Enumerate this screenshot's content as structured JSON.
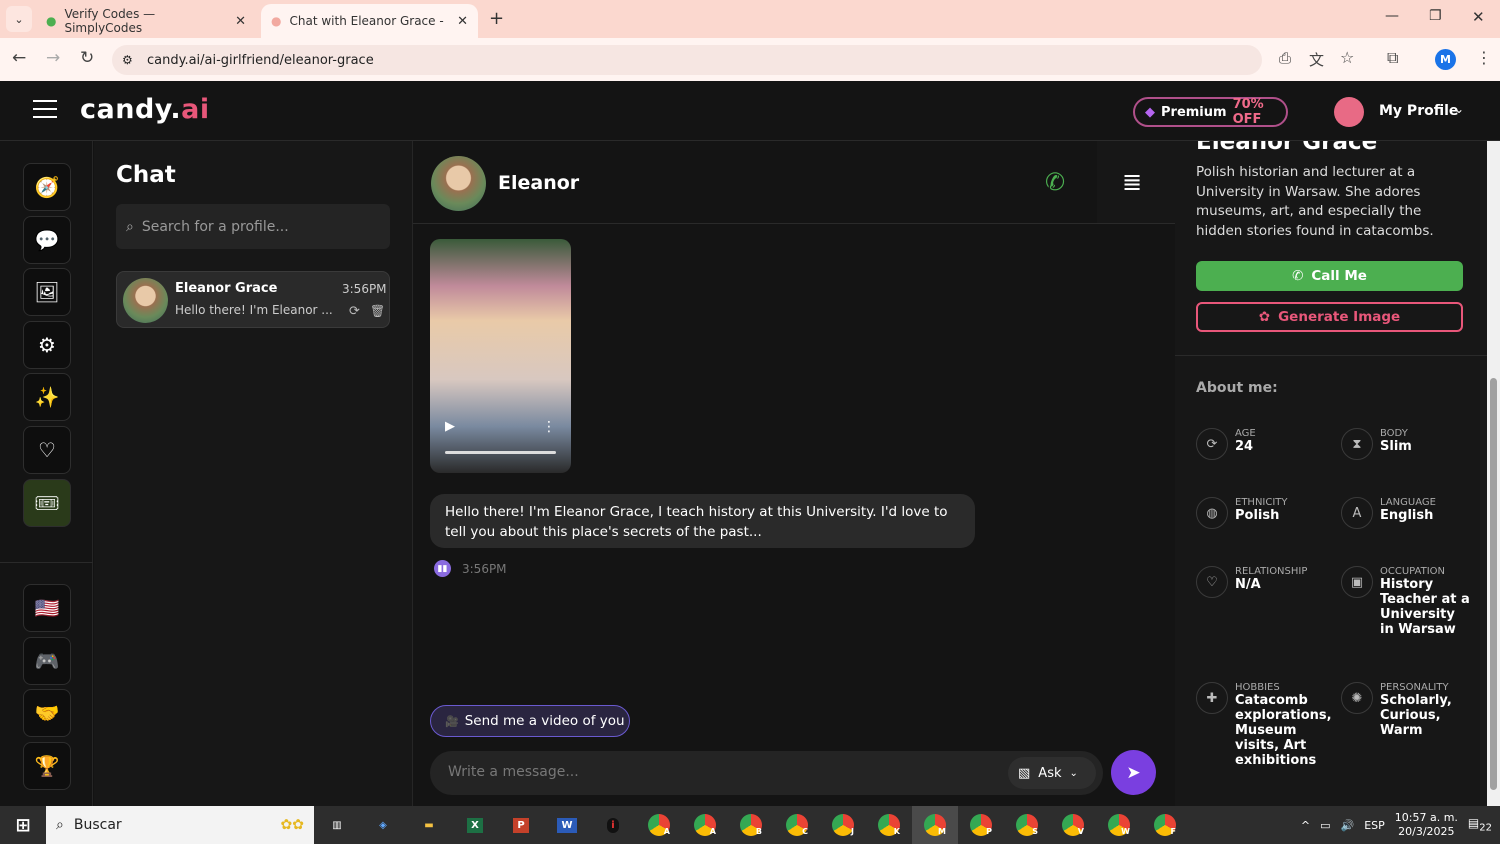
{
  "browser": {
    "tabs": [
      {
        "title": "Verify Codes — SimplyCodes"
      },
      {
        "title": "Chat with Eleanor Grace - AI Gi"
      }
    ],
    "url": "candy.ai/ai-girlfriend/eleanor-grace"
  },
  "header": {
    "logo_main": "candy.",
    "logo_accent": "ai",
    "premium_label": "Premium",
    "premium_discount": "70% OFF",
    "profile_label": "My Profile"
  },
  "chatlist": {
    "title": "Chat",
    "search_placeholder": "Search for a profile...",
    "items": [
      {
        "name": "Eleanor Grace",
        "time": "3:56PM",
        "preview": "Hello there! I'm Eleanor ..."
      }
    ]
  },
  "chat": {
    "name": "Eleanor",
    "message": "Hello there! I'm Eleanor Grace, I teach history at this University. I'd love to tell you about this place's secrets of the past...",
    "message_time": "3:56PM",
    "suggestion": "Send me a video of you",
    "input_placeholder": "Write a message...",
    "mode_label": "Ask"
  },
  "profile": {
    "name": "Eleanor Grace",
    "description": "Polish historian and lecturer at a University in Warsaw. She adores museums, art, and especially the hidden stories found in catacombs.",
    "call_label": "Call Me",
    "generate_label": "Generate Image",
    "about_title": "About me:",
    "attributes": [
      {
        "label": "AGE",
        "value": "24"
      },
      {
        "label": "BODY",
        "value": "Slim"
      },
      {
        "label": "ETHNICITY",
        "value": "Polish"
      },
      {
        "label": "LANGUAGE",
        "value": "English"
      },
      {
        "label": "RELATIONSHIP",
        "value": "N/A"
      },
      {
        "label": "OCCUPATION",
        "value": "History Teacher at a University in Warsaw"
      },
      {
        "label": "HOBBIES",
        "value": "Catacomb explorations, Museum visits, Art exhibitions"
      },
      {
        "label": "PERSONALITY",
        "value": "Scholarly, Curious, Warm"
      }
    ]
  },
  "taskbar": {
    "search": "Buscar",
    "lang": "ESP",
    "time": "10:57 a. m.",
    "date": "20/3/2025",
    "notifications": "22",
    "chrome_profiles": [
      "A",
      "A",
      "B",
      "C",
      "J",
      "K",
      "M",
      "P",
      "S",
      "V",
      "W",
      "F"
    ]
  }
}
